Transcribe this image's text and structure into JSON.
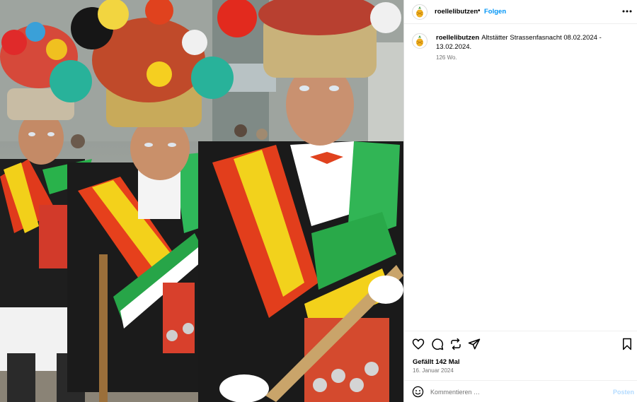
{
  "post": {
    "username": "roellelibutzen",
    "follow_label": "Folgen",
    "separator": "•",
    "caption_username": "roellelibutzen",
    "caption_text": "Altstätter Strassenfasnacht 08.02.2024 - 13.02.2024.",
    "age": "126 Wo.",
    "likes": "Gefällt 142 Mal",
    "date": "16. Januar 2024",
    "comment_placeholder": "Kommentieren …",
    "post_label": "Posten"
  },
  "icons": {
    "more": "more-options-icon",
    "like": "heart-icon",
    "comment": "comment-icon",
    "share": "repost-icon",
    "send": "send-icon",
    "save": "bookmark-icon",
    "emoji": "emoji-icon",
    "avatar": "pineapple-avatar-icon"
  },
  "colors": {
    "accent": "#0095f6",
    "post_disabled": "#b3dbff",
    "muted": "#737373"
  }
}
